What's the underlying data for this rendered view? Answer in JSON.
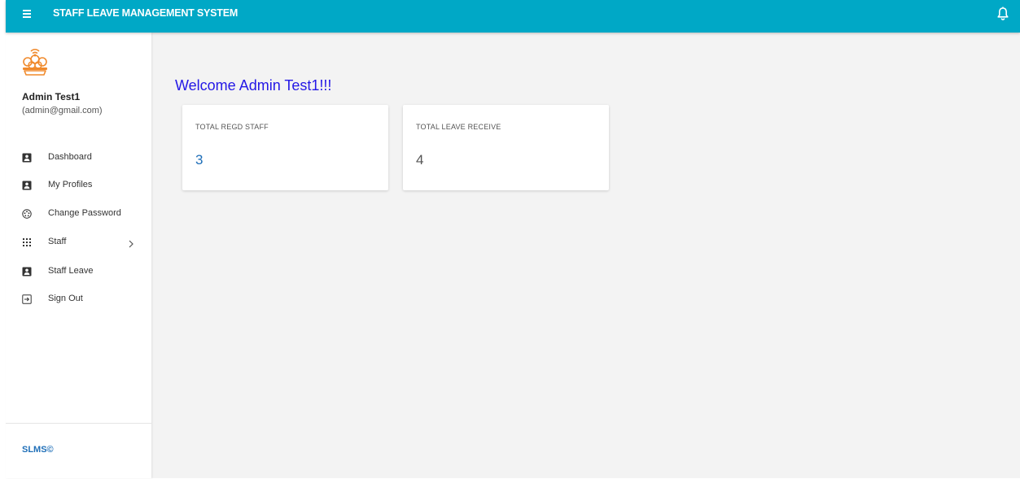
{
  "app": {
    "title": "STAFF LEAVE MANAGEMENT SYSTEM"
  },
  "colors": {
    "header": "#00a8c6",
    "welcome": "#2418e6",
    "stat_blue": "#1f6fb8",
    "stat_gray": "#555555"
  },
  "user": {
    "name": "Admin Test1",
    "email": "(admin@gmail.com)"
  },
  "sidebar": {
    "items": [
      {
        "label": "Dashboard",
        "icon": "id-card-icon"
      },
      {
        "label": "My Profiles",
        "icon": "id-card-icon"
      },
      {
        "label": "Change Password",
        "icon": "settings-icon"
      },
      {
        "label": "Staff",
        "icon": "grid-icon",
        "has_submenu": true
      },
      {
        "label": "Staff Leave",
        "icon": "id-card-icon"
      },
      {
        "label": "Sign Out",
        "icon": "sign-out-icon"
      }
    ],
    "footer": "SLMS©"
  },
  "main": {
    "welcome": "Welcome Admin Test1!!!",
    "cards": [
      {
        "label": "TOTAL REGD STAFF",
        "value": "3"
      },
      {
        "label": "TOTAL LEAVE RECEIVE",
        "value": "4"
      }
    ]
  }
}
